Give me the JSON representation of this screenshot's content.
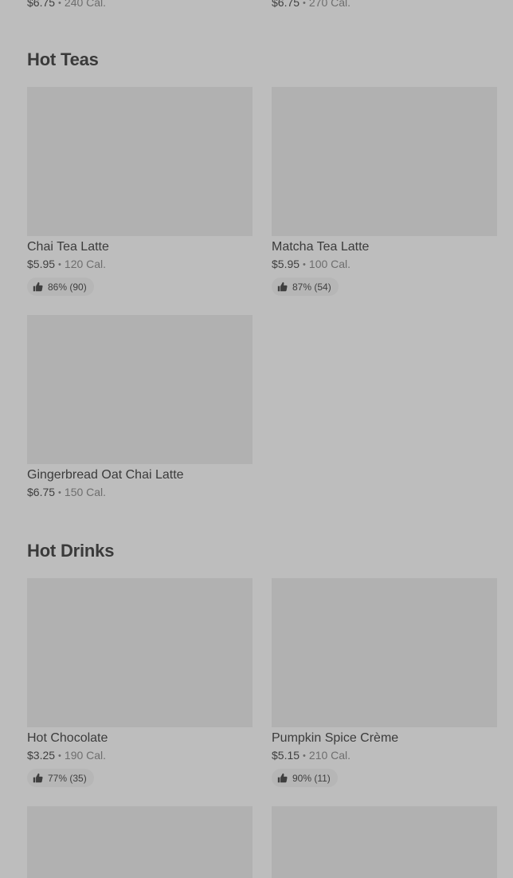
{
  "top_row": [
    {
      "price": "$6.75",
      "sep": "•",
      "calories": "240 Cal."
    },
    {
      "price": "$6.75",
      "sep": "•",
      "calories": "270 Cal."
    }
  ],
  "sections": [
    {
      "title": "Hot Teas",
      "items": [
        {
          "name": "Chai Tea Latte",
          "price": "$5.95",
          "sep": "•",
          "calories": "120 Cal.",
          "rating": "86% (90)"
        },
        {
          "name": "Matcha Tea Latte",
          "price": "$5.95",
          "sep": "•",
          "calories": "100 Cal.",
          "rating": "87% (54)"
        },
        {
          "name": "Gingerbread Oat Chai Latte",
          "price": "$6.75",
          "sep": "•",
          "calories": "150 Cal."
        }
      ]
    },
    {
      "title": "Hot Drinks",
      "items": [
        {
          "name": "Hot Chocolate",
          "price": "$3.25",
          "sep": "•",
          "calories": "190 Cal.",
          "rating": "77% (35)"
        },
        {
          "name": "Pumpkin Spice Crème",
          "price": "$5.15",
          "sep": "•",
          "calories": "210 Cal.",
          "rating": "90% (11)"
        }
      ]
    }
  ],
  "icons": {
    "rating": "thumbs-up-icon"
  },
  "colors": {
    "background": "#bdbdbd",
    "image_placeholder": "#b1b1b1",
    "pill": "#b6b6b6",
    "text": "#3a3a3a"
  }
}
